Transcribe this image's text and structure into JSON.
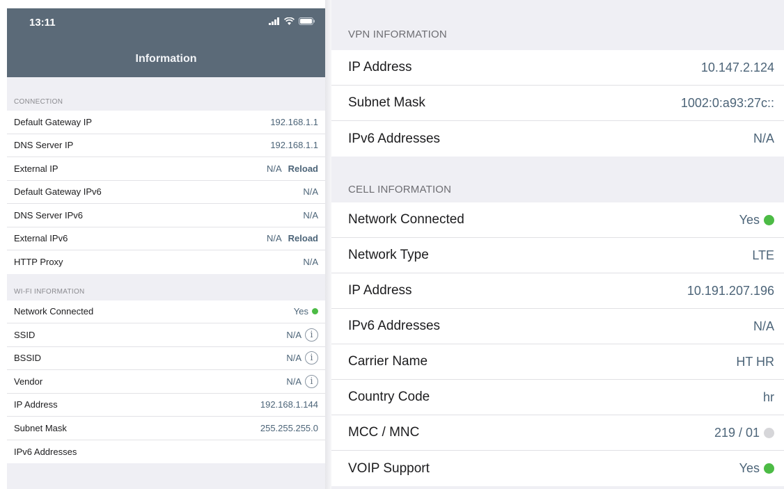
{
  "status_bar": {
    "time": "13:11"
  },
  "nav": {
    "title": "Information"
  },
  "connection": {
    "header": "CONNECTION",
    "rows": [
      {
        "label": "Default Gateway IP",
        "value": "192.168.1.1"
      },
      {
        "label": "DNS Server IP",
        "value": "192.168.1.1"
      },
      {
        "label": "External IP",
        "value": "N/A",
        "action": "Reload"
      },
      {
        "label": "Default Gateway IPv6",
        "value": "N/A"
      },
      {
        "label": "DNS Server IPv6",
        "value": "N/A"
      },
      {
        "label": "External IPv6",
        "value": "N/A",
        "action": "Reload"
      },
      {
        "label": "HTTP Proxy",
        "value": "N/A"
      }
    ]
  },
  "wifi": {
    "header": "WI-FI INFORMATION",
    "rows": [
      {
        "label": "Network Connected",
        "value": "Yes",
        "status_color": "#4cbb45"
      },
      {
        "label": "SSID",
        "value": "N/A",
        "icon": "info-icon"
      },
      {
        "label": "BSSID",
        "value": "N/A",
        "icon": "info-icon"
      },
      {
        "label": "Vendor",
        "value": "N/A",
        "icon": "info-icon"
      },
      {
        "label": "IP Address",
        "value": "192.168.1.144"
      },
      {
        "label": "Subnet Mask",
        "value": "255.255.255.0"
      },
      {
        "label": "IPv6 Addresses",
        "value": ""
      }
    ]
  },
  "vpn": {
    "header": "VPN INFORMATION",
    "rows": [
      {
        "label": "IP Address",
        "value": "10.147.2.124"
      },
      {
        "label": "Subnet Mask",
        "value": "1002:0:a93:27c::"
      },
      {
        "label": "IPv6 Addresses",
        "value": "N/A"
      }
    ]
  },
  "cell": {
    "header": "CELL INFORMATION",
    "rows": [
      {
        "label": "Network Connected",
        "value": "Yes",
        "status_color": "#4cbb45"
      },
      {
        "label": "Network Type",
        "value": "LTE"
      },
      {
        "label": "IP Address",
        "value": "10.191.207.196"
      },
      {
        "label": "IPv6 Addresses",
        "value": "N/A"
      },
      {
        "label": "Carrier Name",
        "value": "HT HR"
      },
      {
        "label": "Country Code",
        "value": "hr"
      },
      {
        "label": "MCC / MNC",
        "value": "219 / 01",
        "status_color": "#d6d6d9"
      },
      {
        "label": "VOIP Support",
        "value": "Yes",
        "status_color": "#4cbb45"
      }
    ]
  },
  "colors": {
    "nav_bar": "#5b6a78",
    "value_text": "#4c6478",
    "status_green": "#4cbb45",
    "status_gray": "#d6d6d9"
  }
}
